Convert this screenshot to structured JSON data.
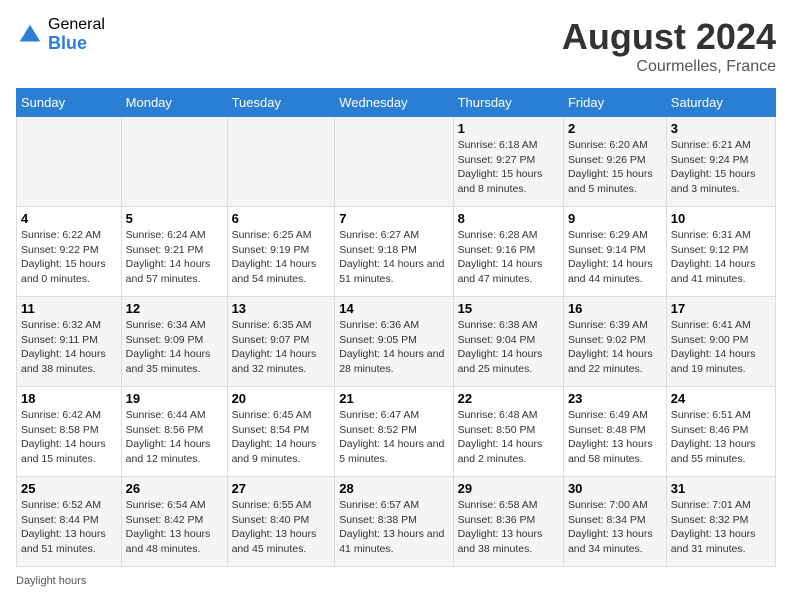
{
  "header": {
    "logo_general": "General",
    "logo_blue": "Blue",
    "month_year": "August 2024",
    "location": "Courmelles, France"
  },
  "days_of_week": [
    "Sunday",
    "Monday",
    "Tuesday",
    "Wednesday",
    "Thursday",
    "Friday",
    "Saturday"
  ],
  "weeks": [
    [
      {
        "day": "",
        "info": ""
      },
      {
        "day": "",
        "info": ""
      },
      {
        "day": "",
        "info": ""
      },
      {
        "day": "",
        "info": ""
      },
      {
        "day": "1",
        "info": "Sunrise: 6:18 AM\nSunset: 9:27 PM\nDaylight: 15 hours and 8 minutes."
      },
      {
        "day": "2",
        "info": "Sunrise: 6:20 AM\nSunset: 9:26 PM\nDaylight: 15 hours and 5 minutes."
      },
      {
        "day": "3",
        "info": "Sunrise: 6:21 AM\nSunset: 9:24 PM\nDaylight: 15 hours and 3 minutes."
      }
    ],
    [
      {
        "day": "4",
        "info": "Sunrise: 6:22 AM\nSunset: 9:22 PM\nDaylight: 15 hours and 0 minutes."
      },
      {
        "day": "5",
        "info": "Sunrise: 6:24 AM\nSunset: 9:21 PM\nDaylight: 14 hours and 57 minutes."
      },
      {
        "day": "6",
        "info": "Sunrise: 6:25 AM\nSunset: 9:19 PM\nDaylight: 14 hours and 54 minutes."
      },
      {
        "day": "7",
        "info": "Sunrise: 6:27 AM\nSunset: 9:18 PM\nDaylight: 14 hours and 51 minutes."
      },
      {
        "day": "8",
        "info": "Sunrise: 6:28 AM\nSunset: 9:16 PM\nDaylight: 14 hours and 47 minutes."
      },
      {
        "day": "9",
        "info": "Sunrise: 6:29 AM\nSunset: 9:14 PM\nDaylight: 14 hours and 44 minutes."
      },
      {
        "day": "10",
        "info": "Sunrise: 6:31 AM\nSunset: 9:12 PM\nDaylight: 14 hours and 41 minutes."
      }
    ],
    [
      {
        "day": "11",
        "info": "Sunrise: 6:32 AM\nSunset: 9:11 PM\nDaylight: 14 hours and 38 minutes."
      },
      {
        "day": "12",
        "info": "Sunrise: 6:34 AM\nSunset: 9:09 PM\nDaylight: 14 hours and 35 minutes."
      },
      {
        "day": "13",
        "info": "Sunrise: 6:35 AM\nSunset: 9:07 PM\nDaylight: 14 hours and 32 minutes."
      },
      {
        "day": "14",
        "info": "Sunrise: 6:36 AM\nSunset: 9:05 PM\nDaylight: 14 hours and 28 minutes."
      },
      {
        "day": "15",
        "info": "Sunrise: 6:38 AM\nSunset: 9:04 PM\nDaylight: 14 hours and 25 minutes."
      },
      {
        "day": "16",
        "info": "Sunrise: 6:39 AM\nSunset: 9:02 PM\nDaylight: 14 hours and 22 minutes."
      },
      {
        "day": "17",
        "info": "Sunrise: 6:41 AM\nSunset: 9:00 PM\nDaylight: 14 hours and 19 minutes."
      }
    ],
    [
      {
        "day": "18",
        "info": "Sunrise: 6:42 AM\nSunset: 8:58 PM\nDaylight: 14 hours and 15 minutes."
      },
      {
        "day": "19",
        "info": "Sunrise: 6:44 AM\nSunset: 8:56 PM\nDaylight: 14 hours and 12 minutes."
      },
      {
        "day": "20",
        "info": "Sunrise: 6:45 AM\nSunset: 8:54 PM\nDaylight: 14 hours and 9 minutes."
      },
      {
        "day": "21",
        "info": "Sunrise: 6:47 AM\nSunset: 8:52 PM\nDaylight: 14 hours and 5 minutes."
      },
      {
        "day": "22",
        "info": "Sunrise: 6:48 AM\nSunset: 8:50 PM\nDaylight: 14 hours and 2 minutes."
      },
      {
        "day": "23",
        "info": "Sunrise: 6:49 AM\nSunset: 8:48 PM\nDaylight: 13 hours and 58 minutes."
      },
      {
        "day": "24",
        "info": "Sunrise: 6:51 AM\nSunset: 8:46 PM\nDaylight: 13 hours and 55 minutes."
      }
    ],
    [
      {
        "day": "25",
        "info": "Sunrise: 6:52 AM\nSunset: 8:44 PM\nDaylight: 13 hours and 51 minutes."
      },
      {
        "day": "26",
        "info": "Sunrise: 6:54 AM\nSunset: 8:42 PM\nDaylight: 13 hours and 48 minutes."
      },
      {
        "day": "27",
        "info": "Sunrise: 6:55 AM\nSunset: 8:40 PM\nDaylight: 13 hours and 45 minutes."
      },
      {
        "day": "28",
        "info": "Sunrise: 6:57 AM\nSunset: 8:38 PM\nDaylight: 13 hours and 41 minutes."
      },
      {
        "day": "29",
        "info": "Sunrise: 6:58 AM\nSunset: 8:36 PM\nDaylight: 13 hours and 38 minutes."
      },
      {
        "day": "30",
        "info": "Sunrise: 7:00 AM\nSunset: 8:34 PM\nDaylight: 13 hours and 34 minutes."
      },
      {
        "day": "31",
        "info": "Sunrise: 7:01 AM\nSunset: 8:32 PM\nDaylight: 13 hours and 31 minutes."
      }
    ]
  ],
  "footer": {
    "daylight_label": "Daylight hours"
  }
}
